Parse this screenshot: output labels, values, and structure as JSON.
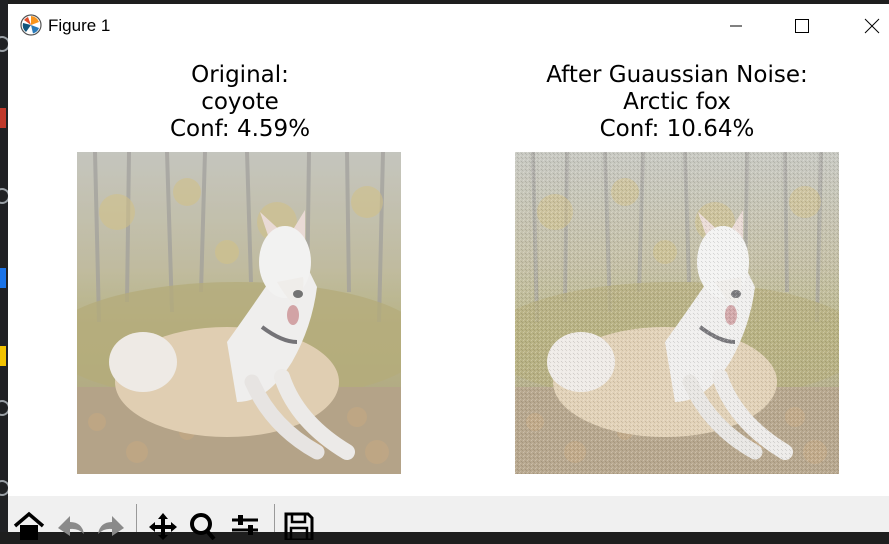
{
  "window": {
    "title": "Figure 1",
    "controls": [
      "minimize",
      "maximize",
      "close"
    ]
  },
  "panels": [
    {
      "title_lines": [
        "Original:",
        "coyote",
        "Conf: 4.59%"
      ],
      "image": "white shepherd dog lying among autumn leaves in forest"
    },
    {
      "title_lines": [
        "After Guaussian Noise:",
        "Arctic fox",
        "Conf: 10.64%"
      ],
      "image": "white shepherd dog lying among autumn leaves in forest (noisy)"
    }
  ],
  "toolbar": {
    "icons": [
      "home-icon",
      "back-icon",
      "forward-icon",
      "pan-icon",
      "zoom-icon",
      "configure-subplots-icon",
      "save-icon"
    ]
  }
}
